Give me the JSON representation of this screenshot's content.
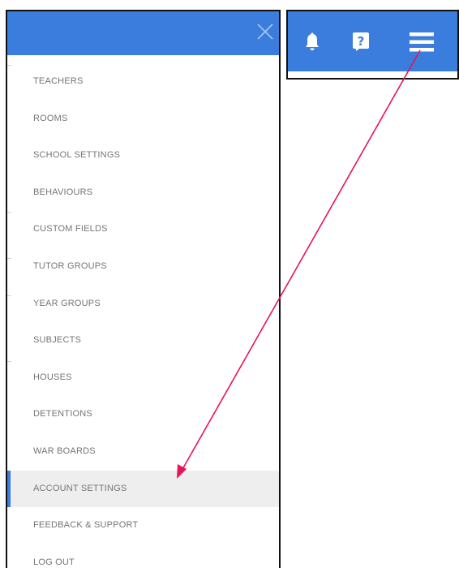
{
  "menu": {
    "items": [
      {
        "label": "TEACHERS"
      },
      {
        "label": "ROOMS"
      },
      {
        "label": "SCHOOL SETTINGS"
      },
      {
        "label": "BEHAVIOURS"
      },
      {
        "label": "CUSTOM FIELDS"
      },
      {
        "label": "TUTOR GROUPS"
      },
      {
        "label": "YEAR GROUPS"
      },
      {
        "label": "SUBJECTS"
      },
      {
        "label": "HOUSES"
      },
      {
        "label": "DETENTIONS"
      },
      {
        "label": "WAR BOARDS"
      },
      {
        "label": "ACCOUNT SETTINGS"
      },
      {
        "label": "FEEDBACK & SUPPORT"
      },
      {
        "label": "LOG OUT"
      }
    ],
    "active_item": "ACCOUNT SETTINGS"
  },
  "icons": {
    "close": "close-icon",
    "bell": "bell-icon",
    "help": "help-icon",
    "menu": "hamburger-menu-icon",
    "help_glyph": "?"
  },
  "colors": {
    "header_blue": "#3b7ddd",
    "annotation_arrow": "#e8135a",
    "active_bg": "#eeeeee",
    "text_grey": "#757575"
  }
}
